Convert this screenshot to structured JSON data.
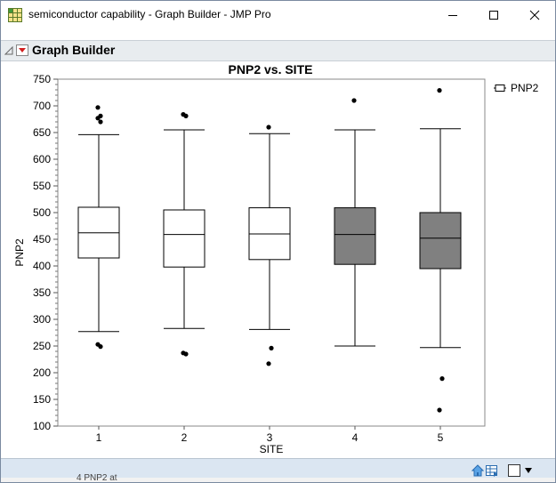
{
  "window": {
    "title": "semiconductor capability - Graph Builder - JMP Pro",
    "icons": {
      "app": "grid-table-icon",
      "minimize": "minimize-icon",
      "maximize": "maximize-icon",
      "close": "close-icon"
    }
  },
  "outline": {
    "title": "Graph Builder",
    "icons": {
      "disclosure": "disclosure-triangle-icon",
      "menu": "red-triangle-menu-icon"
    }
  },
  "legend": {
    "label": "PNP2",
    "icon": "box-legend-icon"
  },
  "statusbar": {
    "icons": [
      "home-icon",
      "table-icon",
      "square-icon",
      "dropdown-icon"
    ]
  },
  "bottom_strip_text": "4 PNP2 at",
  "colors": {
    "box_fill_white": "#ffffff",
    "box_fill_gray": "#808080",
    "plot_bg": "#ffffff",
    "frame": "#8a8a8a"
  },
  "chart_data": {
    "type": "box",
    "title": "PNP2 vs. SITE",
    "xlabel": "SITE",
    "ylabel": "PNP2",
    "categories": [
      "1",
      "2",
      "3",
      "4",
      "5"
    ],
    "ylim": [
      100,
      750
    ],
    "yticks": [
      100,
      150,
      200,
      250,
      300,
      350,
      400,
      450,
      500,
      550,
      600,
      650,
      700,
      750
    ],
    "grid": false,
    "legend_position": "top-right",
    "boxes": [
      {
        "category": "1",
        "min": 277,
        "q1": 415,
        "median": 462,
        "q3": 510,
        "max": 646,
        "outliers": [
          697,
          681,
          677,
          670,
          253,
          249
        ],
        "fill": "white"
      },
      {
        "category": "2",
        "min": 283,
        "q1": 398,
        "median": 459,
        "q3": 505,
        "max": 655,
        "outliers": [
          684,
          681,
          237,
          235
        ],
        "fill": "white"
      },
      {
        "category": "3",
        "min": 281,
        "q1": 412,
        "median": 460,
        "q3": 509,
        "max": 648,
        "outliers": [
          660,
          246,
          217
        ],
        "fill": "white"
      },
      {
        "category": "4",
        "min": 250,
        "q1": 403,
        "median": 459,
        "q3": 509,
        "max": 655,
        "outliers": [
          710
        ],
        "fill": "gray"
      },
      {
        "category": "5",
        "min": 247,
        "q1": 395,
        "median": 452,
        "q3": 500,
        "max": 657,
        "outliers": [
          729,
          189,
          130
        ],
        "fill": "gray"
      }
    ]
  }
}
